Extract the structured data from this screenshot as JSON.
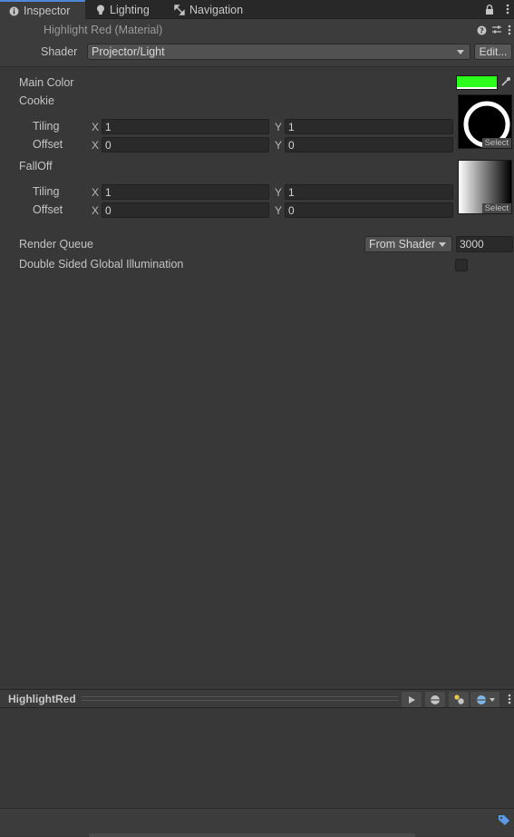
{
  "tabs": [
    {
      "label": "Inspector",
      "icon": "info-icon",
      "active": true
    },
    {
      "label": "Lighting",
      "icon": "lightbulb-icon",
      "active": false
    },
    {
      "label": "Navigation",
      "icon": "navigation-icon",
      "active": false
    }
  ],
  "header": {
    "title": "Highlight Red (Material)",
    "shader_label": "Shader",
    "shader_value": "Projector/Light",
    "edit_label": "Edit..."
  },
  "properties": {
    "main_color_label": "Main Color",
    "main_color_value": "#2dff1c",
    "cookie": {
      "label": "Cookie",
      "tiling_label": "Tiling",
      "offset_label": "Offset",
      "x_label": "X",
      "y_label": "Y",
      "tiling_x": "1",
      "tiling_y": "1",
      "offset_x": "0",
      "offset_y": "0",
      "select_label": "Select"
    },
    "falloff": {
      "label": "FallOff",
      "tiling_label": "Tiling",
      "offset_label": "Offset",
      "x_label": "X",
      "y_label": "Y",
      "tiling_x": "1",
      "tiling_y": "1",
      "offset_x": "0",
      "offset_y": "0",
      "select_label": "Select"
    },
    "render_queue_label": "Render Queue",
    "render_queue_mode": "From Shader",
    "render_queue_value": "3000",
    "double_sided_gi_label": "Double Sided Global Illumination",
    "double_sided_gi_checked": false
  },
  "preview": {
    "title": "HighlightRed"
  },
  "colors": {
    "accent": "#4d87d6",
    "panel_bg": "#383838",
    "field_bg": "#2a2a2a"
  }
}
